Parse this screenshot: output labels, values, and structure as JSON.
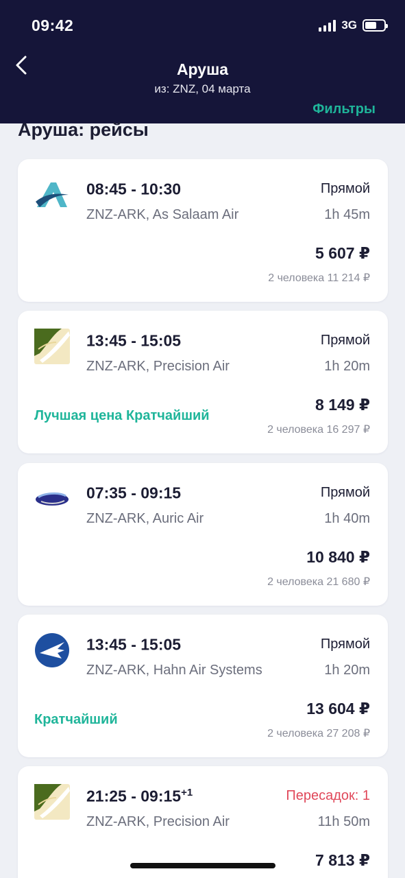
{
  "status_bar": {
    "time": "09:42",
    "network": "3G"
  },
  "header": {
    "title": "Аруша",
    "subtitle": "из: ZNZ, 04 марта",
    "filters_label": "Фильтры"
  },
  "section_title": "Аруша: рейсы",
  "colors": {
    "header_bg": "#151539",
    "accent": "#1fb59a",
    "transfer": "#e0485a"
  },
  "flights": [
    {
      "logo": "as-salaam-air-logo",
      "times": "08:45 - 10:30",
      "day_offset": "",
      "route": "ZNZ-ARK, As Salaam Air",
      "stops": "Прямой",
      "duration": "1h 45m",
      "price": "5 607 ₽",
      "total": "2 человека 11 214 ₽",
      "tag": ""
    },
    {
      "logo": "precision-air-logo",
      "times": "13:45 - 15:05",
      "day_offset": "",
      "route": "ZNZ-ARK, Precision Air",
      "stops": "Прямой",
      "duration": "1h 20m",
      "price": "8 149 ₽",
      "total": "2 человека 16 297 ₽",
      "tag": "Лучшая цена Кратчайший"
    },
    {
      "logo": "auric-air-logo",
      "times": "07:35 - 09:15",
      "day_offset": "",
      "route": "ZNZ-ARK, Auric Air",
      "stops": "Прямой",
      "duration": "1h 40m",
      "price": "10 840 ₽",
      "total": "2 человека 21 680 ₽",
      "tag": ""
    },
    {
      "logo": "hahn-air-logo",
      "times": "13:45 - 15:05",
      "day_offset": "",
      "route": "ZNZ-ARK, Hahn Air Systems",
      "stops": "Прямой",
      "duration": "1h 20m",
      "price": "13 604 ₽",
      "total": "2 человека 27 208 ₽",
      "tag": "Кратчайший"
    },
    {
      "logo": "precision-air-logo",
      "times": "21:25 - 09:15",
      "day_offset": "+1",
      "route": "ZNZ-ARK, Precision Air",
      "stops": "Пересадок: 1",
      "duration": "11h 50m",
      "price": "7 813 ₽",
      "total": "",
      "tag": ""
    }
  ]
}
